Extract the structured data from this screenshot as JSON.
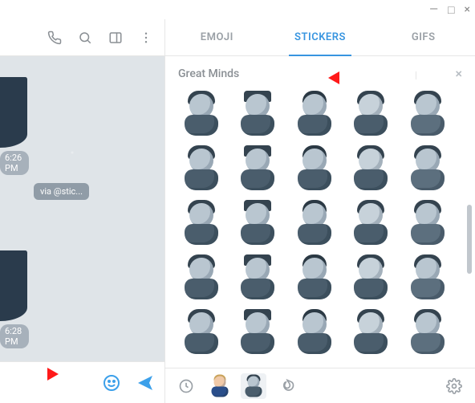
{
  "window_controls": {
    "minimize": "—",
    "maximize": "□",
    "close": "×"
  },
  "left_header": {
    "call_icon": "call-icon",
    "search_icon": "search-icon",
    "sidebar_icon": "sidebar-toggle-icon",
    "more_icon": "more-vertical-icon"
  },
  "chat": {
    "messages": [
      {
        "time": "6:26 PM"
      },
      {
        "time": "6:28 PM"
      }
    ],
    "via_label": "via @stic..."
  },
  "tabs": [
    {
      "id": "emoji",
      "label": "EMOJI",
      "active": false
    },
    {
      "id": "stickers",
      "label": "STICKERS",
      "active": true
    },
    {
      "id": "gifs",
      "label": "GIFS",
      "active": false
    }
  ],
  "pack": {
    "title": "Great Minds",
    "close": "×",
    "sticker_count_visible": 25
  },
  "tray": {
    "recent_icon": "recent-icon",
    "trending_icon": "flame-icon",
    "settings_icon": "gear-icon"
  }
}
